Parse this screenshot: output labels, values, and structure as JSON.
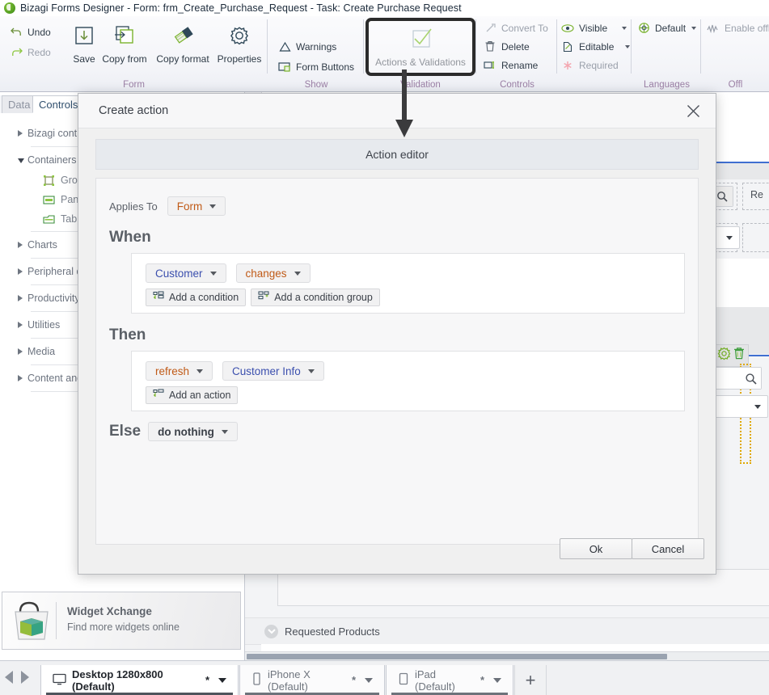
{
  "titlebar": {
    "app_title": "Bizagi Forms Designer  - Form: frm_Create_Purchase_Request - Task:  Create Purchase Request",
    "logo_icon": "bizagi-logo-icon"
  },
  "ribbon": {
    "groups": [
      {
        "label": "Form"
      },
      {
        "label": "Show"
      },
      {
        "label": "Validation"
      },
      {
        "label": "Controls"
      },
      {
        "label": "Languages"
      },
      {
        "label": "Offl"
      }
    ],
    "undo_label": "Undo",
    "redo_label": "Redo",
    "save_label": "Save",
    "copy_from_label": "Copy from",
    "copy_format_label": "Copy format",
    "properties_label": "Properties",
    "warnings_label": "Warnings",
    "form_buttons_label": "Form Buttons",
    "actions_validations_label": "Actions & Validations",
    "convert_to_label": "Convert To",
    "delete_label": "Delete",
    "rename_label": "Rename",
    "visible_label": "Visible",
    "editable_label": "Editable",
    "required_label": "Required",
    "default_label": "Default",
    "enable_offline_label": "Enable offli"
  },
  "left_panel": {
    "tabs": [
      {
        "label": "Data",
        "active": false
      },
      {
        "label": "Controls",
        "active": true
      }
    ],
    "tree": [
      {
        "label": "Bizagi contr",
        "expanded": false,
        "children": []
      },
      {
        "label": "Containers",
        "expanded": true,
        "children": [
          {
            "label": "Group",
            "icon": "group-icon"
          },
          {
            "label": "Panel",
            "icon": "panel-icon"
          },
          {
            "label": "Tab",
            "icon": "tab-icon"
          }
        ]
      },
      {
        "label": "Charts",
        "expanded": false,
        "children": []
      },
      {
        "label": "Peripheral d",
        "expanded": false,
        "children": []
      },
      {
        "label": "Productivity",
        "expanded": false,
        "children": []
      },
      {
        "label": "Utilities",
        "expanded": false,
        "children": []
      },
      {
        "label": "Media",
        "expanded": false,
        "children": []
      },
      {
        "label": "Content and",
        "expanded": false,
        "children": []
      }
    ],
    "widget_xchange": {
      "title": "Widget Xchange",
      "subtitle": "Find more widgets online",
      "icon": "shopping-bag-icon"
    }
  },
  "canvas": {
    "requested_products_label": "Requested Products",
    "re_label": "Re",
    "search_icon": "magnifier-icon",
    "gear_icon": "gear-icon",
    "trash_icon": "trash-icon"
  },
  "dialog": {
    "title": "Create action",
    "close_icon": "close-icon",
    "editor_header": "Action editor",
    "applies_to_label": "Applies To",
    "applies_to_value": "Form",
    "when_title": "When",
    "when_condition_field": "Customer",
    "when_condition_operator": "changes",
    "add_condition_label": "Add a condition",
    "add_condition_group_label": "Add a condition group",
    "then_title": "Then",
    "then_action": "refresh",
    "then_target": "Customer Info",
    "add_action_label": "Add an action",
    "else_title": "Else",
    "else_value": "do nothing",
    "ok_label": "Ok",
    "cancel_label": "Cancel"
  },
  "device_bar": {
    "prev_icon": "arrow-left-icon",
    "next_icon": "arrow-right-icon",
    "tabs": [
      {
        "label": "Desktop 1280x800 (Default)",
        "modified": "*",
        "icon": "monitor-icon",
        "active": true
      },
      {
        "label": "iPhone X (Default)",
        "modified": "*",
        "icon": "phone-icon",
        "active": false
      },
      {
        "label": "iPad (Default)",
        "modified": "*",
        "icon": "tablet-icon",
        "active": false
      }
    ],
    "add_label": "+"
  },
  "colors": {
    "accent_green": "#8cc63f",
    "orange_value": "#c05a17",
    "blue_value": "#3b4fae",
    "group_label_purple": "#9b7fa5",
    "highlight_border": "#2b2b2b"
  }
}
